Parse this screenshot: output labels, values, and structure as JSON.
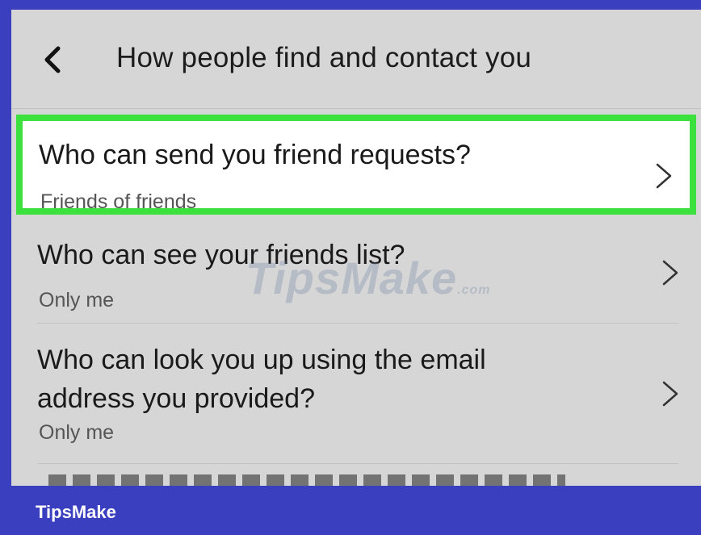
{
  "header": {
    "title": "How people find and contact you",
    "back_icon": "chevron-left-icon"
  },
  "rows": [
    {
      "question": "Who can send you friend requests?",
      "answer": "Friends of friends",
      "highlighted": true,
      "highlight_color": "#3ce13e"
    },
    {
      "question": "Who can see your friends list?",
      "answer": "Only me"
    },
    {
      "question_line1": "Who can look you up using the email",
      "question_line2": "address you provided?",
      "answer": "Only me"
    }
  ],
  "watermark": {
    "text": "TipsMake",
    "suffix": ".com"
  },
  "footer": {
    "brand": "TipsMake",
    "color": "#3a3fc0"
  }
}
